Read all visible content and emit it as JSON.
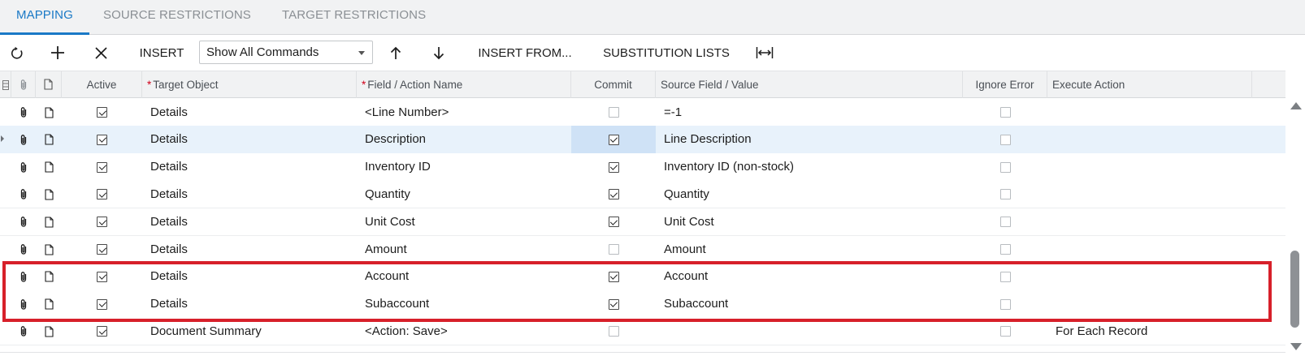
{
  "tabs": [
    {
      "label": "MAPPING",
      "active": true
    },
    {
      "label": "SOURCE RESTRICTIONS",
      "active": false
    },
    {
      "label": "TARGET RESTRICTIONS",
      "active": false
    }
  ],
  "toolbar": {
    "refresh_icon": "refresh-icon",
    "add_icon": "plus-icon",
    "delete_icon": "close-icon",
    "insert_label": "INSERT",
    "command_filter": {
      "selected": "Show All Commands"
    },
    "move_up_icon": "arrow-up-icon",
    "move_down_icon": "arrow-down-icon",
    "insert_from_label": "INSERT FROM...",
    "substitution_lists_label": "SUBSTITUTION LISTS",
    "fit_columns_icon": "fit-width-icon"
  },
  "grid": {
    "columns": {
      "active": "Active",
      "target_object": "Target Object",
      "field_action": "Field / Action Name",
      "commit": "Commit",
      "source_field": "Source Field / Value",
      "ignore_error": "Ignore Error",
      "execute_action": "Execute Action"
    },
    "required_marker": "*",
    "rows": [
      {
        "active": true,
        "target_object": "Details",
        "field_action": "<Line Number>",
        "commit": false,
        "source_field": "=-1",
        "ignore_error": false,
        "execute_action": ""
      },
      {
        "active": true,
        "target_object": "Details",
        "field_action": "Description",
        "commit": true,
        "source_field": "Line Description",
        "ignore_error": false,
        "execute_action": "",
        "selected": true
      },
      {
        "active": true,
        "target_object": "Details",
        "field_action": "Inventory ID",
        "commit": true,
        "source_field": "Inventory ID (non-stock)",
        "ignore_error": false,
        "execute_action": ""
      },
      {
        "active": true,
        "target_object": "Details",
        "field_action": "Quantity",
        "commit": true,
        "source_field": "Quantity",
        "ignore_error": false,
        "execute_action": ""
      },
      {
        "active": true,
        "target_object": "Details",
        "field_action": "Unit Cost",
        "commit": true,
        "source_field": "Unit Cost",
        "ignore_error": false,
        "execute_action": ""
      },
      {
        "active": true,
        "target_object": "Details",
        "field_action": "Amount",
        "commit": false,
        "source_field": "Amount",
        "ignore_error": false,
        "execute_action": ""
      },
      {
        "active": true,
        "target_object": "Details",
        "field_action": "Account",
        "commit": true,
        "source_field": "Account",
        "ignore_error": false,
        "execute_action": "",
        "highlighted": true
      },
      {
        "active": true,
        "target_object": "Details",
        "field_action": "Subaccount",
        "commit": true,
        "source_field": "Subaccount",
        "ignore_error": false,
        "execute_action": "",
        "highlighted": true
      },
      {
        "active": true,
        "target_object": "Document Summary",
        "field_action": "<Action: Save>",
        "commit": false,
        "source_field": "",
        "ignore_error": false,
        "execute_action": "For Each Record"
      }
    ]
  },
  "colors": {
    "accent": "#1a79c6",
    "highlight_box": "#d7202a",
    "selected_row": "#e8f2fb"
  }
}
